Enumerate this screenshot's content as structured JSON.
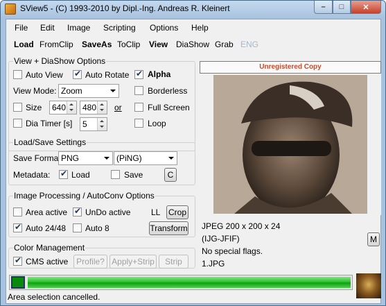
{
  "window": {
    "title": "SView5 - (C) 1993-2010 by Dipl.-Ing. Andreas R. Kleinert",
    "min_label": "–",
    "max_label": "□",
    "close_label": "✕"
  },
  "menu": [
    "File",
    "Edit",
    "Image",
    "Scripting",
    "Options",
    "Help"
  ],
  "toolbar": {
    "load": "Load",
    "fromclip": "FromClip",
    "saveas": "SaveAs",
    "toclip": "ToClip",
    "view": "View",
    "diashow": "DiaShow",
    "grab": "Grab",
    "eng": "ENG"
  },
  "view_group": {
    "title": "View + DiaShow Options",
    "auto_view": "Auto View",
    "auto_rotate": "Auto Rotate",
    "alpha": "Alpha",
    "view_mode_label": "View Mode:",
    "view_mode_value": "Zoom",
    "borderless": "Borderless",
    "size_label": "Size",
    "size_w": "640",
    "size_h": "480",
    "or": "or",
    "full_screen": "Full Screen",
    "dia_timer_label": "Dia Timer [s]",
    "dia_timer_value": "5",
    "loop": "Loop"
  },
  "load_save_group": {
    "title": "Load/Save Settings",
    "save_format_label": "Save Format:",
    "save_format_value": "PNG",
    "save_format_ext": "(PiNG)",
    "metadata_label": "Metadata:",
    "load": "Load",
    "save": "Save",
    "c_button": "C"
  },
  "image_proc_group": {
    "title": "Image Processing / AutoConv Options",
    "area_active": "Area active",
    "undo_active": "UnDo active",
    "ll": "LL",
    "crop": "Crop",
    "auto_24_48": "Auto 24/48",
    "auto_8": "Auto 8",
    "transform": "Transform"
  },
  "color_group": {
    "title": "Color Management",
    "cms_active": "CMS active",
    "profile": "Profile?",
    "apply_strip": "Apply+Strip",
    "strip": "Strip"
  },
  "preview": {
    "unregistered": "Unregistered Copy",
    "info1": "JPEG 200 x 200 x 24",
    "info2": "(IJG-JFIF)",
    "info3": "No special flags.",
    "info4": "1.JPG",
    "m_button": "M"
  },
  "status": {
    "text": "Area selection cancelled.",
    "progress": 1.0
  }
}
